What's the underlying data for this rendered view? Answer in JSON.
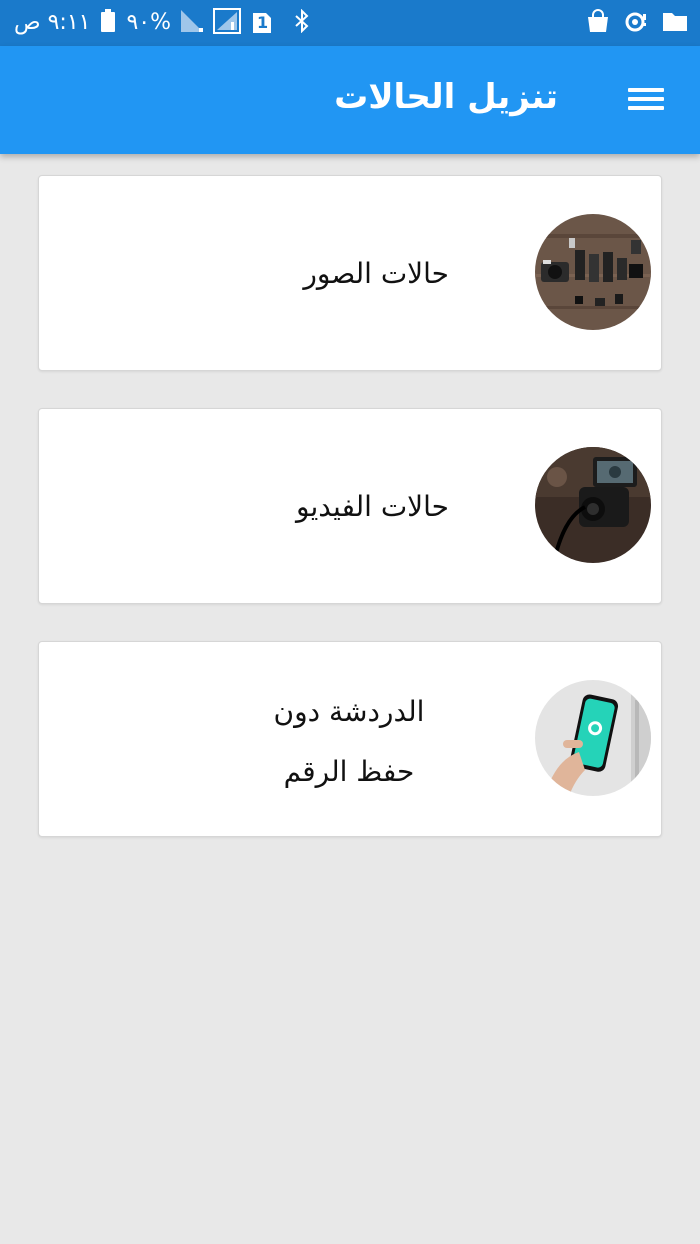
{
  "status_bar": {
    "time": "٩:١١ ص",
    "battery": "٩٠%",
    "sim_number": "1",
    "icons": [
      "battery-icon",
      "signal-icon",
      "sim-icon",
      "bluetooth-icon",
      "shopping-bag-icon",
      "sync-icon",
      "folder-icon"
    ]
  },
  "app_bar": {
    "title": "تنزيل الحالات",
    "menu_icon": "hamburger-menu-icon"
  },
  "cards": [
    {
      "label": "حالات الصور",
      "thumb": "camera-collection-photo"
    },
    {
      "label": "حالات الفيديو",
      "thumb": "video-camera-photo"
    },
    {
      "label_line1": "الدردشة دون",
      "label_line2": "حفظ الرقم",
      "thumb": "whatsapp-phone-photo"
    }
  ],
  "colors": {
    "status_bar": "#1a7acb",
    "app_bar": "#2196f3",
    "background": "#e8e8e8",
    "card": "#ffffff"
  }
}
